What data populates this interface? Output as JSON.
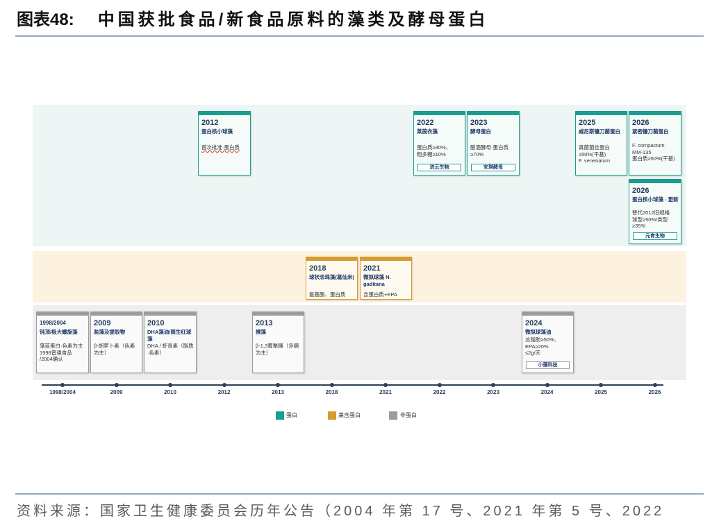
{
  "title": {
    "label": "图表48:",
    "text": "中国获批食品/新食品原料的藻类及酵母蛋白"
  },
  "categories": [
    {
      "name": "蛋白",
      "color": "#1a9e8f"
    },
    {
      "name": "兼含蛋白",
      "color": "#d89b2e"
    },
    {
      "name": "非蛋白",
      "color": "#9c9c9c"
    }
  ],
  "cards": [
    {
      "category": 2,
      "year": "1998/2004",
      "name": "钝顶/极大螺旋藻",
      "desc": [
        "藻蓝蛋白·色素为主",
        "1998普通食品",
        "/2004确认"
      ]
    },
    {
      "category": 2,
      "year": "2009",
      "name": "盐藻及提取物",
      "desc": [
        "β-胡萝卜素（色素为主）"
      ]
    },
    {
      "category": 2,
      "year": "2010",
      "name": "DHA藻油/雨生红球藻",
      "desc": [
        "DHA / 虾青素（脂质·色素）"
      ]
    },
    {
      "category": 0,
      "year": "2012",
      "name": "蛋白核小球藻",
      "desc": [
        "首次批准·蛋白质"
      ]
    },
    {
      "category": 2,
      "year": "2013",
      "name": "裸藻",
      "desc": [
        "β-1,3葡聚糖（多糖为主）"
      ]
    },
    {
      "category": 1,
      "year": "2018",
      "name": "球状念珠藻(葛仙米)",
      "desc": [
        "氨基酸、蛋白质"
      ]
    },
    {
      "category": 1,
      "year": "2021",
      "name": "微拟球藻 N. gaditana",
      "desc": [
        "含蛋白质+EPA"
      ]
    },
    {
      "category": 0,
      "year": "2022",
      "name": "莱茵衣藻",
      "desc": [
        "蛋白质≥30%、",
        "粗多糖≥10%"
      ],
      "badge": "进云生物"
    },
    {
      "category": 0,
      "year": "2023",
      "name": "酵母蛋白",
      "desc": [
        "酿酒酵母·蛋白质",
        "≥70%"
      ],
      "badge": "安琪酵母"
    },
    {
      "category": 2,
      "year": "2024",
      "name": "微拟球藻油",
      "desc": [
        "总脂肪≥50%、",
        "EPA≥20%",
        "≤2g/天"
      ],
      "badge": "小藻科技"
    },
    {
      "category": 0,
      "year": "2025",
      "name": "威尼斯镰刀菌蛋白",
      "desc": [
        "真菌菌丝蛋白",
        "≥50%(干基)",
        "F. venenatum"
      ]
    },
    {
      "category": 0,
      "year": "2026",
      "name": "紧密镰刀菌蛋白",
      "desc": [
        "F. compactum",
        "MM-135",
        "蛋白质≥50%(干基)"
      ]
    },
    {
      "category": 0,
      "year": "2026",
      "name": "蛋白核小球藻 - 更新",
      "desc": [
        "替代2012旧规格",
        "球型≥50%/类型",
        "≥35%"
      ],
      "badge": "元育生物"
    }
  ],
  "axis": {
    "years": [
      "1998/2004",
      "2009",
      "2010",
      "2012",
      "2013",
      "2018",
      "2021",
      "2022",
      "2023",
      "2024",
      "2025",
      "2026"
    ]
  },
  "source": "资料来源：国家卫生健康委员会历年公告（2004 年第 17 号、2021 年第 5 号、2022"
}
